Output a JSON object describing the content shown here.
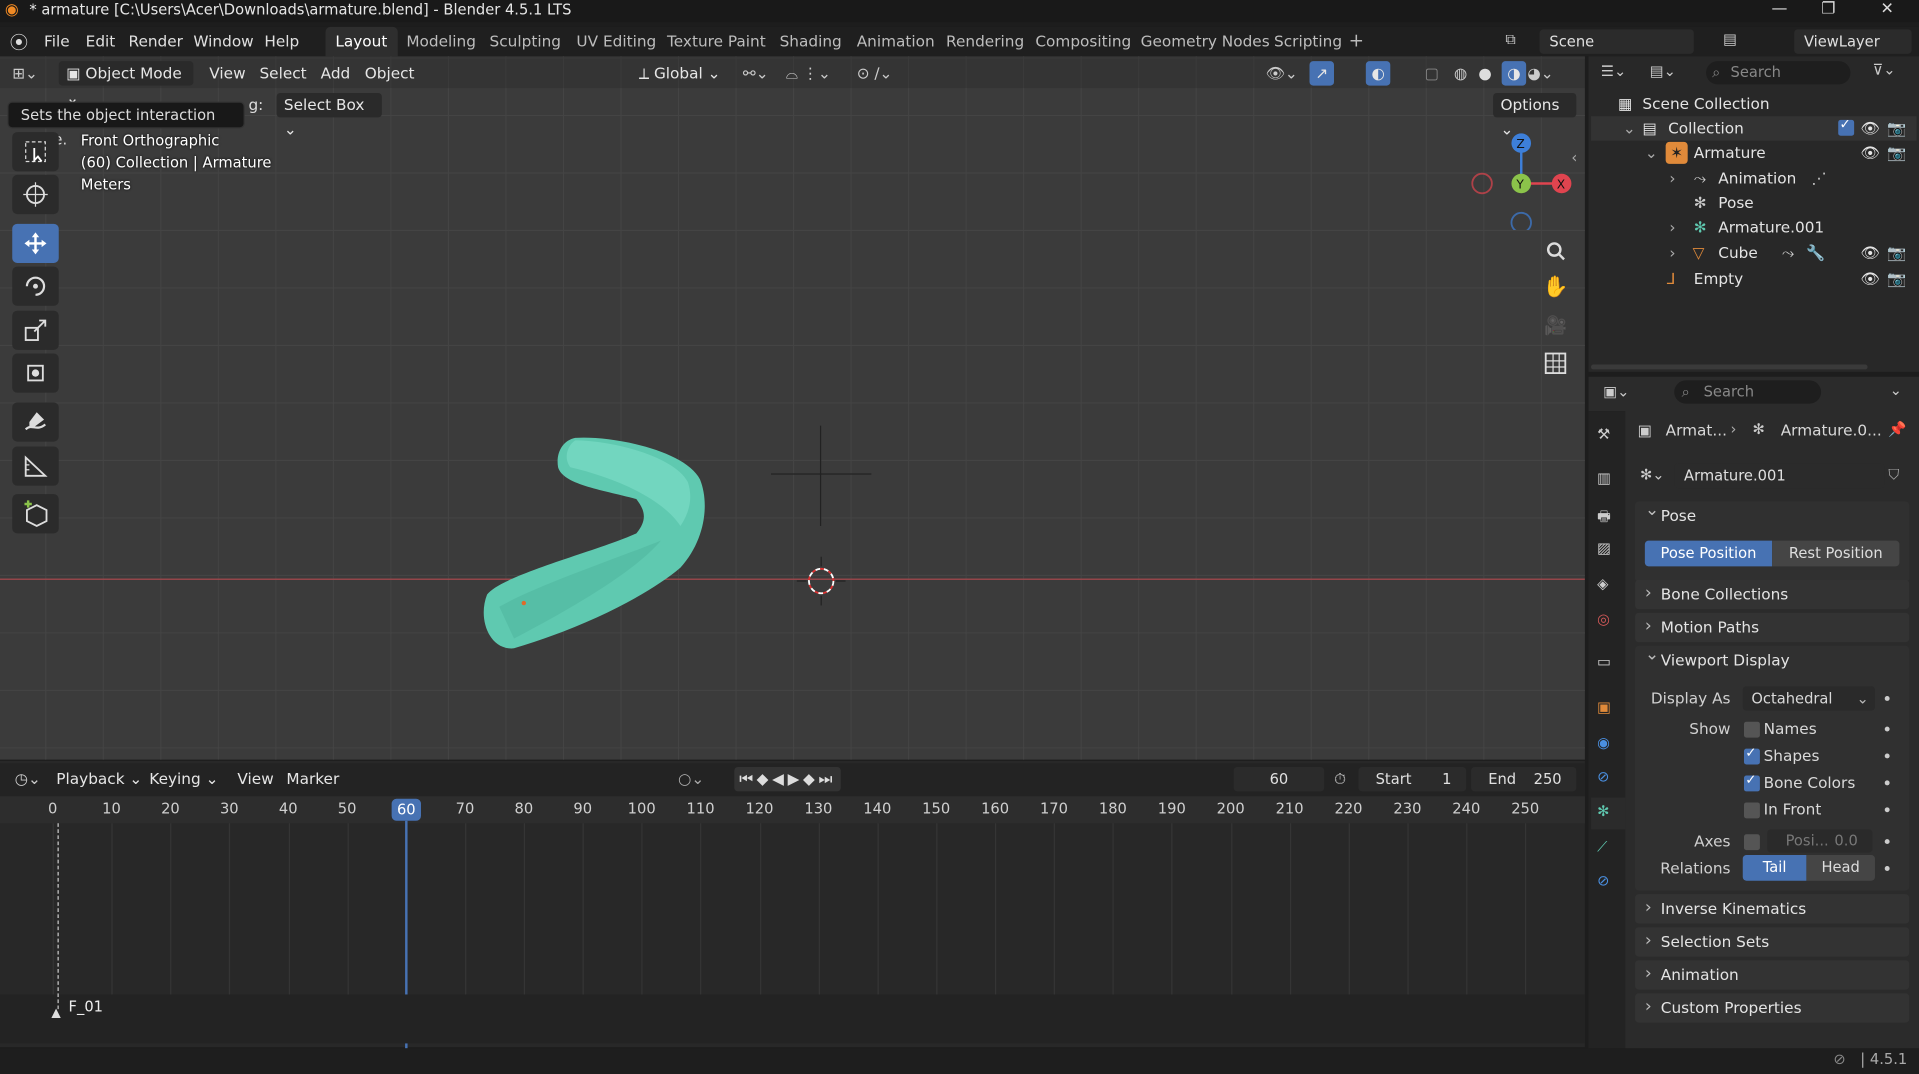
{
  "window": {
    "title": "* armature [C:\\Users\\Acer\\Downloads\\armature.blend] - Blender 4.5.1 LTS"
  },
  "menu": [
    "File",
    "Edit",
    "Render",
    "Window",
    "Help"
  ],
  "workspaces": [
    "Layout",
    "Modeling",
    "Sculpting",
    "UV Editing",
    "Texture Paint",
    "Shading",
    "Animation",
    "Rendering",
    "Compositing",
    "Geometry Nodes",
    "Scripting"
  ],
  "scene": {
    "name": "Scene",
    "view_layer": "ViewLayer"
  },
  "viewport_header": {
    "mode": "Object Mode",
    "menus": [
      "View",
      "Select",
      "Add",
      "Object"
    ],
    "orientation": "Global",
    "drag_label": "g:",
    "drag_value": "Select Box",
    "options": "Options"
  },
  "tooltip": "Sets the object interaction mode.",
  "overlay": {
    "view_name": "Front Orthographic",
    "collection_info": "(60) Collection | Armature",
    "units": "Meters"
  },
  "gizmo": {
    "z": "Z",
    "y": "Y",
    "x": "X"
  },
  "timeline": {
    "menus": [
      "Playback",
      "Keying",
      "View",
      "Marker"
    ],
    "current_frame": "60",
    "start_label": "Start",
    "start": "1",
    "end_label": "End",
    "end": "250",
    "ticks": [
      "0",
      "10",
      "20",
      "30",
      "40",
      "50",
      "60",
      "70",
      "80",
      "90",
      "100",
      "110",
      "120",
      "130",
      "140",
      "150",
      "160",
      "170",
      "180",
      "190",
      "200",
      "210",
      "220",
      "230",
      "240",
      "250"
    ],
    "marker": "F_01"
  },
  "outliner": {
    "search_placeholder": "Search",
    "scene_collection": "Scene Collection",
    "items": [
      "Collection",
      "Armature",
      "Animation",
      "Pose",
      "Armature.001",
      "Cube",
      "Empty"
    ]
  },
  "properties": {
    "search_placeholder": "Search",
    "breadcrumb_a": "Armat...",
    "breadcrumb_b": "Armature.0...",
    "data_name": "Armature.001",
    "pose_panel": "Pose",
    "pose_position": "Pose Position",
    "rest_position": "Rest Position",
    "panels": [
      "Bone Collections",
      "Motion Paths",
      "Viewport Display",
      "Inverse Kinematics",
      "Selection Sets",
      "Animation",
      "Custom Properties"
    ],
    "display_as_label": "Display As",
    "display_as": "Octahedral",
    "show_label": "Show",
    "show_names": "Names",
    "show_shapes": "Shapes",
    "show_bone_colors": "Bone Colors",
    "show_in_front": "In Front",
    "axes_label": "Axes",
    "axes_field": "Posi...",
    "axes_value": "0.0",
    "relations_label": "Relations",
    "rel_tail": "Tail",
    "rel_head": "Head"
  },
  "status": {
    "version": "4.5.1"
  },
  "colors": {
    "accent": "#4772b3",
    "mesh": "#5fc9b0",
    "x_axis": "#e0444f",
    "y_axis": "#8bc34a",
    "z_axis": "#3d7fd9"
  }
}
